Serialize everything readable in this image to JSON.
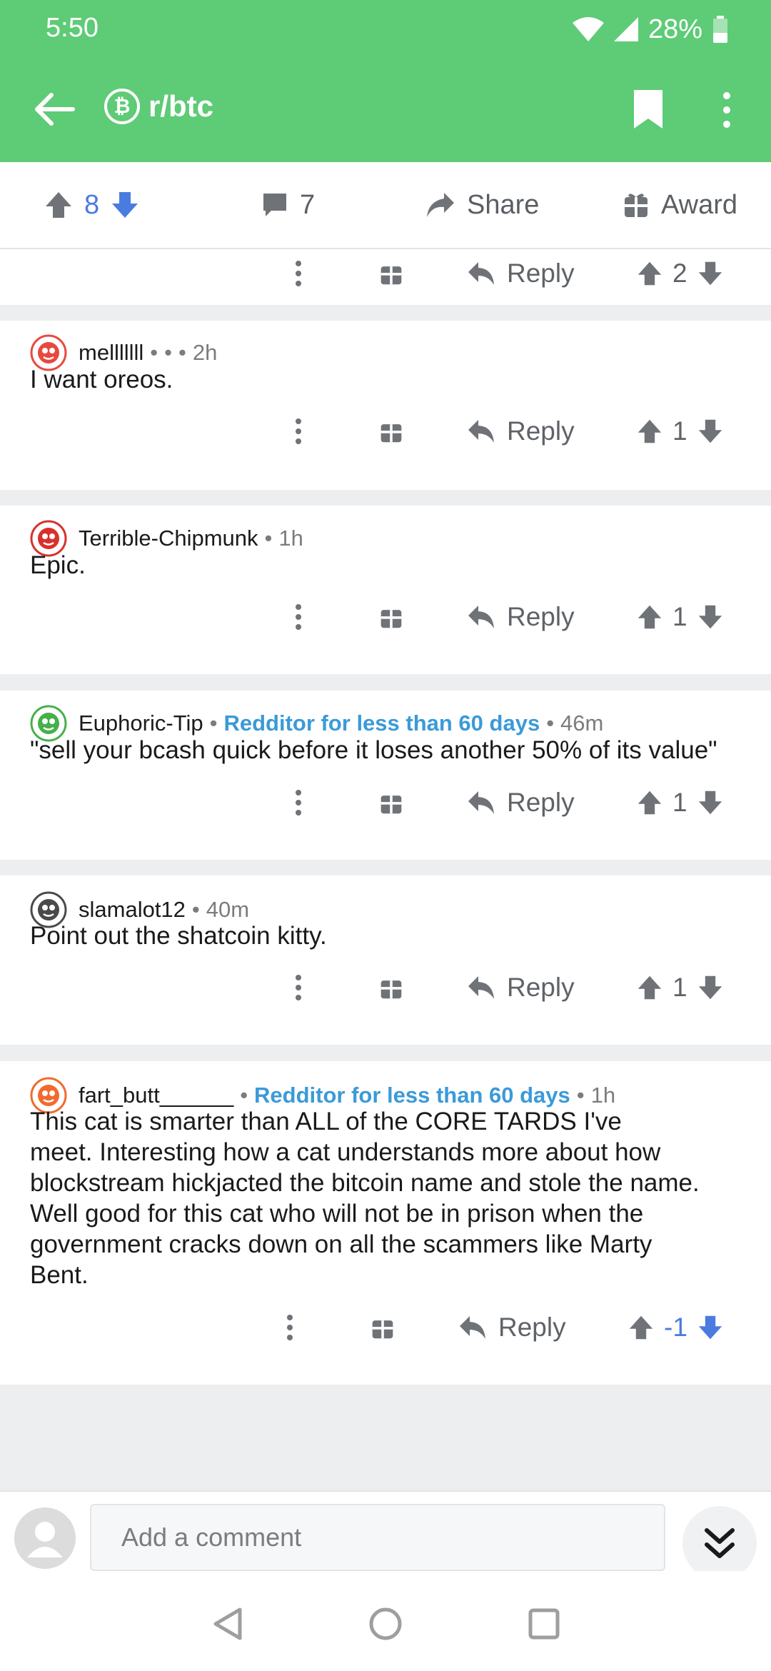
{
  "status": {
    "time": "5:50",
    "battery": "28%"
  },
  "header": {
    "subreddit": "r/btc",
    "logo_glyph": "₿"
  },
  "post_bar": {
    "score": "8",
    "comments": "7",
    "share": "Share",
    "award": "Award"
  },
  "labels": {
    "reply": "Reply"
  },
  "partial_comment": {
    "score": "2"
  },
  "comments": [
    {
      "user": "melllllll",
      "extra": "•",
      "time": "2h",
      "flair": "",
      "body": "I want oreos.",
      "score": "1",
      "avatar_color": "#e8493f"
    },
    {
      "user": "Terrible-Chipmunk",
      "extra": "",
      "time": "1h",
      "flair": "",
      "body": "Epic.",
      "score": "1",
      "avatar_color": "#d9302c"
    },
    {
      "user": "Euphoric-Tip",
      "extra": "",
      "time": "46m",
      "flair": "Redditor for less than 60 days",
      "body": "\"sell your bcash quick before it loses another 50% of its value\"",
      "score": "1",
      "avatar_color": "#46b04a"
    },
    {
      "user": "slamalot12",
      "extra": "",
      "time": "40m",
      "flair": "",
      "body": "Point out the shatcoin kitty.",
      "score": "1",
      "avatar_color": "#4a4a4a"
    },
    {
      "user": "fart_butt______",
      "extra": "",
      "time": "1h",
      "flair": "Redditor for less than 60 days",
      "body": "This cat is smarter than ALL of the CORE TARDS I've\nmeet.  Interesting how a cat understands more about how\nblockstream hickjacted the bitcoin name and stole the name.\nWell good for this cat who will not be in prison when the\ngovernment cracks down on all the scammers like Marty\nBent.",
      "score": "-1",
      "avatar_color": "#f26a2e"
    }
  ],
  "composer": {
    "placeholder": "Add a comment"
  },
  "colors": {
    "brand": "#5ecb76",
    "vote_blue": "#4a7ce0",
    "flair": "#3b9ad9"
  }
}
